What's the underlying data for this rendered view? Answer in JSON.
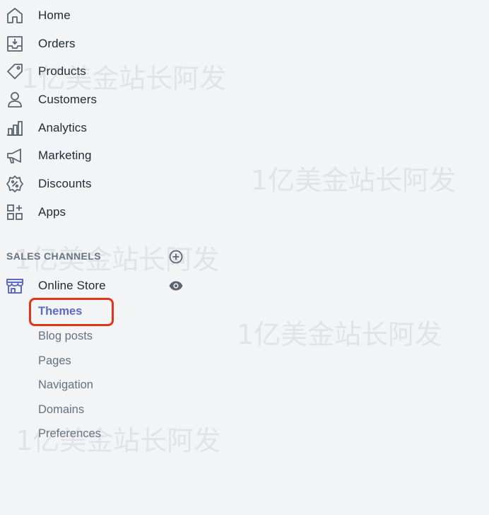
{
  "nav": {
    "items": [
      {
        "label": "Home",
        "icon": "home-icon"
      },
      {
        "label": "Orders",
        "icon": "orders-icon"
      },
      {
        "label": "Products",
        "icon": "tag-icon"
      },
      {
        "label": "Customers",
        "icon": "person-icon"
      },
      {
        "label": "Analytics",
        "icon": "bar-chart-icon"
      },
      {
        "label": "Marketing",
        "icon": "megaphone-icon"
      },
      {
        "label": "Discounts",
        "icon": "discount-icon"
      },
      {
        "label": "Apps",
        "icon": "apps-icon"
      }
    ]
  },
  "sales_channels": {
    "header": "SALES CHANNELS",
    "channel": {
      "label": "Online Store",
      "icon": "store-icon"
    },
    "sub_items": [
      {
        "label": "Themes"
      },
      {
        "label": "Blog posts"
      },
      {
        "label": "Pages"
      },
      {
        "label": "Navigation"
      },
      {
        "label": "Domains"
      },
      {
        "label": "Preferences"
      }
    ]
  },
  "watermark": "1亿美金站长阿发",
  "colors": {
    "background": "#f3f4f6",
    "text": "#212b36",
    "subdued": "#637381",
    "accent": "#5c6ac4",
    "highlight_border": "#e0351c"
  }
}
